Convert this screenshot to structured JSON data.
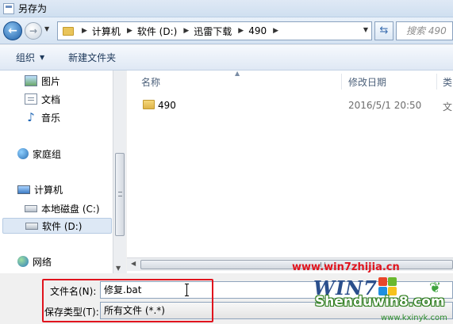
{
  "window": {
    "title": "另存为"
  },
  "navigation": {
    "breadcrumb": [
      "计算机",
      "软件 (D:)",
      "迅雷下载",
      "490"
    ],
    "search_placeholder": "搜索 490"
  },
  "toolbar": {
    "organize_label": "组织",
    "new_folder_label": "新建文件夹"
  },
  "nav_pane": {
    "items": [
      {
        "label": "图片",
        "icon": "pictures-icon"
      },
      {
        "label": "文档",
        "icon": "documents-icon"
      },
      {
        "label": "音乐",
        "icon": "music-icon"
      },
      {
        "label": "家庭组",
        "icon": "homegroup-icon"
      },
      {
        "label": "计算机",
        "icon": "computer-icon"
      },
      {
        "label": "本地磁盘 (C:)",
        "icon": "drive-icon"
      },
      {
        "label": "软件 (D:)",
        "icon": "drive-icon",
        "selected": true
      },
      {
        "label": "网络",
        "icon": "network-icon"
      }
    ]
  },
  "file_list": {
    "columns": {
      "name": "名称",
      "modified": "修改日期",
      "type": "类"
    },
    "rows": [
      {
        "name": "490",
        "modified": "2016/5/1 20:50",
        "type": "文",
        "icon": "folder-icon"
      }
    ]
  },
  "save_fields": {
    "filename_label": "文件名(N):",
    "filename_value": "修复.bat",
    "filetype_label": "保存类型(T):",
    "filetype_value": "所有文件  (*.*)"
  },
  "watermark": {
    "site_url": "www.win7zhijia.cn",
    "brand": "Shenduwin8.com",
    "brand_url": "www.kxinyk.com",
    "logo_text": "WIN7"
  },
  "colors": {
    "highlight": "#e0141e",
    "accent": "#1f5fa8"
  }
}
